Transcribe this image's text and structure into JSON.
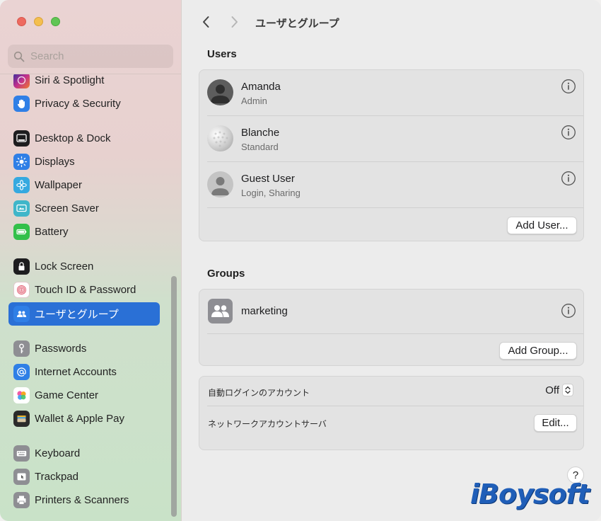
{
  "sidebar": {
    "search_placeholder": "Search",
    "items": [
      {
        "label": "Siri & Spotlight",
        "icon": "siri-icon"
      },
      {
        "label": "Privacy & Security",
        "icon": "hand-icon"
      },
      {
        "label": "Desktop & Dock",
        "icon": "dock-icon"
      },
      {
        "label": "Displays",
        "icon": "sun-icon"
      },
      {
        "label": "Wallpaper",
        "icon": "flower-icon"
      },
      {
        "label": "Screen Saver",
        "icon": "screen-saver-icon"
      },
      {
        "label": "Battery",
        "icon": "battery-icon"
      },
      {
        "label": "Lock Screen",
        "icon": "lock-icon"
      },
      {
        "label": "Touch ID & Password",
        "icon": "fingerprint-icon"
      },
      {
        "label": "ユーザとグループ",
        "icon": "users-icon"
      },
      {
        "label": "Passwords",
        "icon": "key-icon"
      },
      {
        "label": "Internet Accounts",
        "icon": "at-icon"
      },
      {
        "label": "Game Center",
        "icon": "game-center-icon"
      },
      {
        "label": "Wallet & Apple Pay",
        "icon": "wallet-icon"
      },
      {
        "label": "Keyboard",
        "icon": "keyboard-icon"
      },
      {
        "label": "Trackpad",
        "icon": "trackpad-icon"
      },
      {
        "label": "Printers & Scanners",
        "icon": "printer-icon"
      }
    ],
    "active_index": 9
  },
  "toolbar": {
    "title": "ユーザとグループ"
  },
  "users_section": {
    "heading": "Users",
    "users": [
      {
        "name": "Amanda",
        "role": "Admin"
      },
      {
        "name": "Blanche",
        "role": "Standard"
      },
      {
        "name": "Guest User",
        "role": "Login, Sharing"
      }
    ],
    "add_user_label": "Add User..."
  },
  "groups_section": {
    "heading": "Groups",
    "groups": [
      {
        "name": "marketing"
      }
    ],
    "add_group_label": "Add Group..."
  },
  "settings": {
    "auto_login_label": "自動ログインのアカウント",
    "auto_login_value": "Off",
    "network_server_label": "ネットワークアカウントサーバ",
    "edit_label": "Edit..."
  },
  "help_label": "?",
  "watermark": "iBoysoft",
  "colors": {
    "accent": "#2a70d6",
    "active_item_bg": "#2a70d6"
  }
}
